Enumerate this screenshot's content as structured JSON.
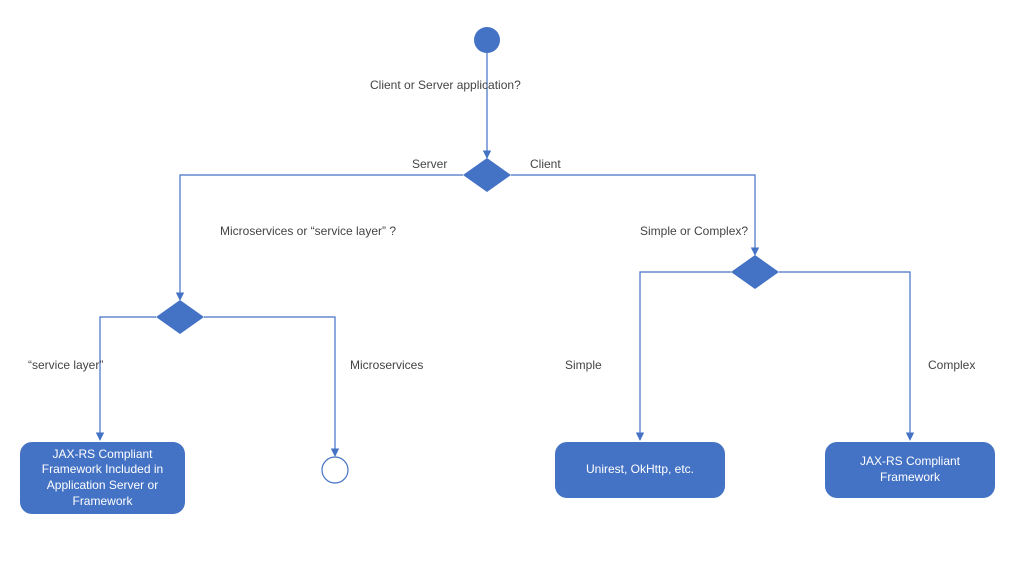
{
  "questions": {
    "root": "Client or Server application?",
    "server_branch": "Microservices or “service layer” ?",
    "client_branch": "Simple or Complex?"
  },
  "edges": {
    "server": "Server",
    "client": "Client",
    "service_layer": "“service layer”",
    "microservices": "Microservices",
    "simple": "Simple",
    "complex": "Complex"
  },
  "terminals": {
    "jaxrs_full": "JAX-RS Compliant Framework Included in Application Server or Framework",
    "simple_clients": "Unirest, OkHttp, etc.",
    "jaxrs_client": "JAX-RS Compliant Framework"
  }
}
